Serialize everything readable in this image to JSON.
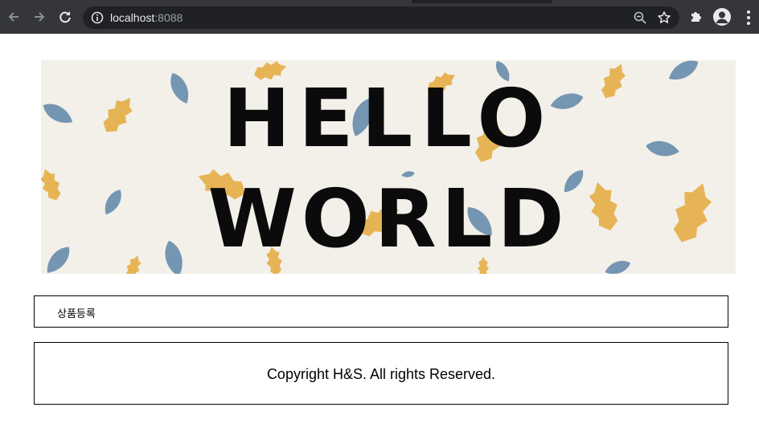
{
  "browser": {
    "url_host": "localhost",
    "url_port": ":8088",
    "icons": {
      "back": "arrow-left-icon",
      "forward": "arrow-right-icon",
      "reload": "reload-icon",
      "site_info": "info-icon",
      "zoom": "zoom-out-icon",
      "bookmark": "star-icon",
      "extensions": "puzzle-icon",
      "profile": "avatar-icon",
      "menu": "kebab-menu-icon"
    }
  },
  "banner": {
    "line1": "HELLO",
    "line2": "WORLD",
    "colors": {
      "background": "#f3f0ea",
      "leaf_orange": "#e6a93a",
      "leaf_blue": "#5f86a8",
      "text": "#0b0b0b"
    }
  },
  "menu": {
    "register_label": "상품등록"
  },
  "footer": {
    "copyright": "Copyright H&S. All rights Reserved."
  }
}
